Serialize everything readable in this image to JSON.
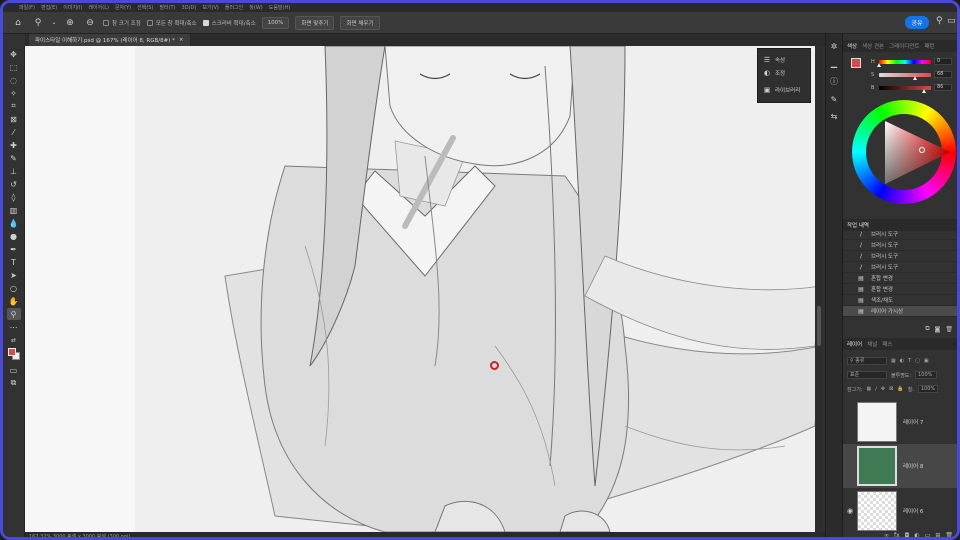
{
  "menubar": {
    "items": [
      "파일(F)",
      "편집(E)",
      "이미지(I)",
      "레이어(L)",
      "문자(Y)",
      "선택(S)",
      "필터(T)",
      "3D(D)",
      "보기(V)",
      "플러그인",
      "창(W)",
      "도움말(H)"
    ]
  },
  "options": {
    "home_icon": "home-icon",
    "zoom_tool_icon": "zoom-tool-icon",
    "zoom_in_icon": "zoom-in-icon",
    "zoom_out_icon": "zoom-out-icon",
    "resize_windows_label": "창 크기 조정",
    "resize_windows_checked": false,
    "zoom_all_label": "모든 창 확대/축소",
    "zoom_all_checked": false,
    "scrubby_zoom_label": "스크러비 확대/축소",
    "scrubby_zoom_checked": true,
    "zoom_value": "100%",
    "fit_screen_label": "화면 맞추기",
    "fill_screen_label": "화면 채우기",
    "share_label": "공유"
  },
  "document": {
    "tab_title": "파이스타일 이해하기.psd @ 167% (레이어 8, RGB/8#) *",
    "close_icon": "close-icon",
    "status_text": "167.32%   3000 픽셀 x 3000 픽셀 (300 ppi)"
  },
  "flypanel": {
    "items": [
      {
        "icon": "properties-icon",
        "label": "속성"
      },
      {
        "icon": "adjustments-icon",
        "label": "조정"
      },
      {
        "icon": "libraries-icon",
        "label": "라이브러리"
      }
    ]
  },
  "color_panel": {
    "tabs": [
      "색상",
      "색상 견본",
      "그레이디언트",
      "패턴"
    ],
    "active_tab": "색상",
    "h_label": "H",
    "h_value": "0",
    "s_label": "S",
    "s_value": "68",
    "b_label": "B",
    "b_value": "86",
    "foreground_color": "#d94a4a"
  },
  "history_panel": {
    "tab": "작업 내역",
    "rows": [
      {
        "icon": "brush-icon",
        "label": "브러시 도구",
        "selected": false
      },
      {
        "icon": "brush-icon",
        "label": "브러시 도구",
        "selected": false
      },
      {
        "icon": "brush-icon",
        "label": "브러시 도구",
        "selected": false
      },
      {
        "icon": "brush-icon",
        "label": "브러시 도구",
        "selected": false
      },
      {
        "icon": "history-state-icon",
        "label": "혼합 변경",
        "selected": false
      },
      {
        "icon": "history-state-icon",
        "label": "혼합 변경",
        "selected": false
      },
      {
        "icon": "history-state-icon",
        "label": "색조/채도",
        "selected": false
      },
      {
        "icon": "history-state-icon",
        "label": "레이어 가시성",
        "selected": true
      }
    ]
  },
  "layers_panel": {
    "tabs": [
      "레이어",
      "채널",
      "패스"
    ],
    "active_tab": "레이어",
    "filter_label": "종류",
    "blend_mode": "표준",
    "opacity_label": "불투명도:",
    "opacity_value": "100%",
    "lock_label": "잠그기:",
    "fill_label": "칠:",
    "fill_value": "100%",
    "layers": [
      {
        "name": "레이어 7",
        "visible": false,
        "selected": false
      },
      {
        "name": "레이어 8",
        "visible": false,
        "selected": true
      },
      {
        "name": "레이어 6",
        "visible": true,
        "selected": false
      }
    ]
  }
}
